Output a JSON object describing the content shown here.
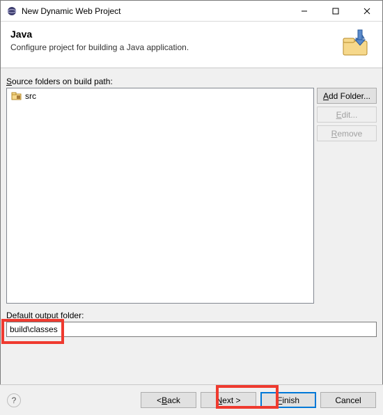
{
  "window": {
    "title": "New Dynamic Web Project"
  },
  "header": {
    "title": "Java",
    "subtitle": "Configure project for building a Java application."
  },
  "source": {
    "label_pre": "",
    "label_mn": "S",
    "label_post": "ource folders on build path:",
    "items": [
      {
        "name": "src"
      }
    ]
  },
  "buttons": {
    "add_pre": "",
    "add_mn": "A",
    "add_post": "dd Folder...",
    "edit_pre": "",
    "edit_mn": "E",
    "edit_post": "dit...",
    "remove_pre": "",
    "remove_mn": "R",
    "remove_post": "emove"
  },
  "output": {
    "label_pre": "",
    "label_mn": "D",
    "label_post": "efault output folder:",
    "value": "build\\classes"
  },
  "footer": {
    "help": "?",
    "back_pre": "< ",
    "back_mn": "B",
    "back_post": "ack",
    "next_pre": "",
    "next_mn": "N",
    "next_post": "ext >",
    "finish_pre": "",
    "finish_mn": "F",
    "finish_post": "inish",
    "cancel": "Cancel"
  }
}
